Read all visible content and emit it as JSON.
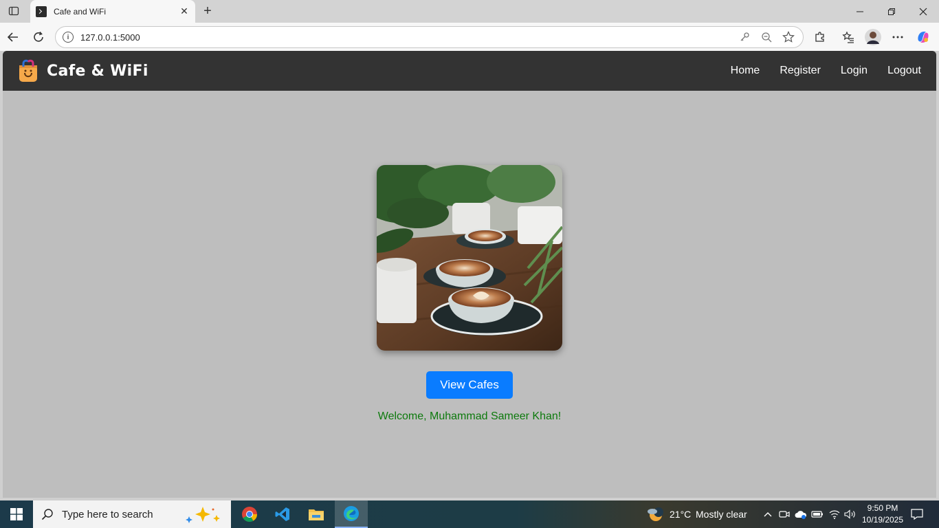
{
  "browser": {
    "tab_title": "Cafe and WiFi",
    "url": "127.0.0.1:5000"
  },
  "site": {
    "brand": "Cafe & WiFi",
    "nav": [
      {
        "label": "Home"
      },
      {
        "label": "Register"
      },
      {
        "label": "Login"
      },
      {
        "label": "Logout"
      }
    ],
    "cta_label": "View Cafes",
    "welcome": "Welcome, Muhammad Sameer Khan!"
  },
  "taskbar": {
    "search_placeholder": "Type here to search",
    "weather_temp": "21°C",
    "weather_text": "Mostly clear",
    "time": "9:50 PM",
    "date": "10/19/2025"
  },
  "colors": {
    "navbar_bg": "#333333",
    "page_bg": "#bebebe",
    "cta_bg": "#0a7cff",
    "welcome_text": "#0d7a0d"
  }
}
